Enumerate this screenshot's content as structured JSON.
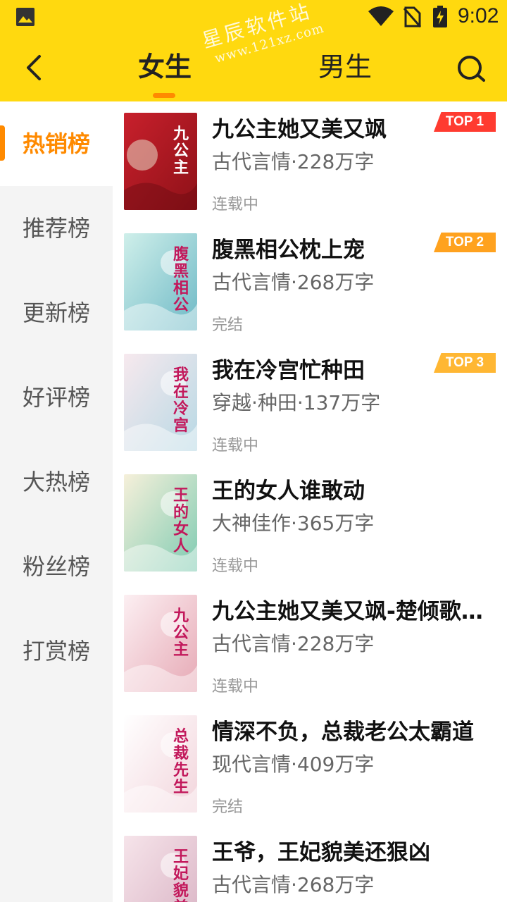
{
  "status_bar": {
    "time": "9:02"
  },
  "header": {
    "tabs": [
      {
        "label": "女生",
        "active": true
      },
      {
        "label": "男生",
        "active": false
      }
    ],
    "watermark": {
      "line1": "星辰软件站",
      "line2": "www.121xz.com"
    },
    "accent_color": "#FFD90F",
    "indicator_color": "#FF8A00"
  },
  "sidebar": {
    "items": [
      {
        "label": "热销榜",
        "active": true
      },
      {
        "label": "推荐榜",
        "active": false
      },
      {
        "label": "更新榜",
        "active": false
      },
      {
        "label": "好评榜",
        "active": false
      },
      {
        "label": "大热榜",
        "active": false
      },
      {
        "label": "粉丝榜",
        "active": false
      },
      {
        "label": "打赏榜",
        "active": false
      }
    ]
  },
  "books": [
    {
      "title": "九公主她又美又飒",
      "meta": "古代言情·228万字",
      "status": "连载中",
      "badge": "TOP 1",
      "cover_text": "九公主",
      "cover_colors": [
        "#C8202C",
        "#8E1118"
      ]
    },
    {
      "title": "腹黑相公枕上宠",
      "meta": "古代言情·268万字",
      "status": "完结",
      "badge": "TOP 2",
      "cover_text": "腹黑相公",
      "cover_colors": [
        "#CFEFEA",
        "#6EB9C6"
      ]
    },
    {
      "title": "我在冷宫忙种田",
      "meta": "穿越·种田·137万字",
      "status": "连载中",
      "badge": "TOP 3",
      "cover_text": "我在冷宫",
      "cover_colors": [
        "#F7E9EE",
        "#B7D8E4"
      ]
    },
    {
      "title": "王的女人谁敢动",
      "meta": "大神佳作·365万字",
      "status": "连载中",
      "badge": "",
      "cover_text": "王的女人",
      "cover_colors": [
        "#F6F0DA",
        "#7FCBB2"
      ]
    },
    {
      "title": "九公主她又美又飒-楚倾歌风…",
      "meta": "古代言情·228万字",
      "status": "连载中",
      "badge": "",
      "cover_text": "九公主",
      "cover_colors": [
        "#FCEFF2",
        "#E6A9B5"
      ]
    },
    {
      "title": "情深不负，总裁老公太霸道",
      "meta": "现代言情·409万字",
      "status": "完结",
      "badge": "",
      "cover_text": "总裁先生",
      "cover_colors": [
        "#FFFFFF",
        "#F2D4DB"
      ]
    },
    {
      "title": "王爷，王妃貌美还狠凶",
      "meta": "古代言情·268万字",
      "status": "",
      "badge": "",
      "cover_text": "王妃貌美",
      "cover_colors": [
        "#F6E4EA",
        "#D9B3C4"
      ]
    }
  ]
}
